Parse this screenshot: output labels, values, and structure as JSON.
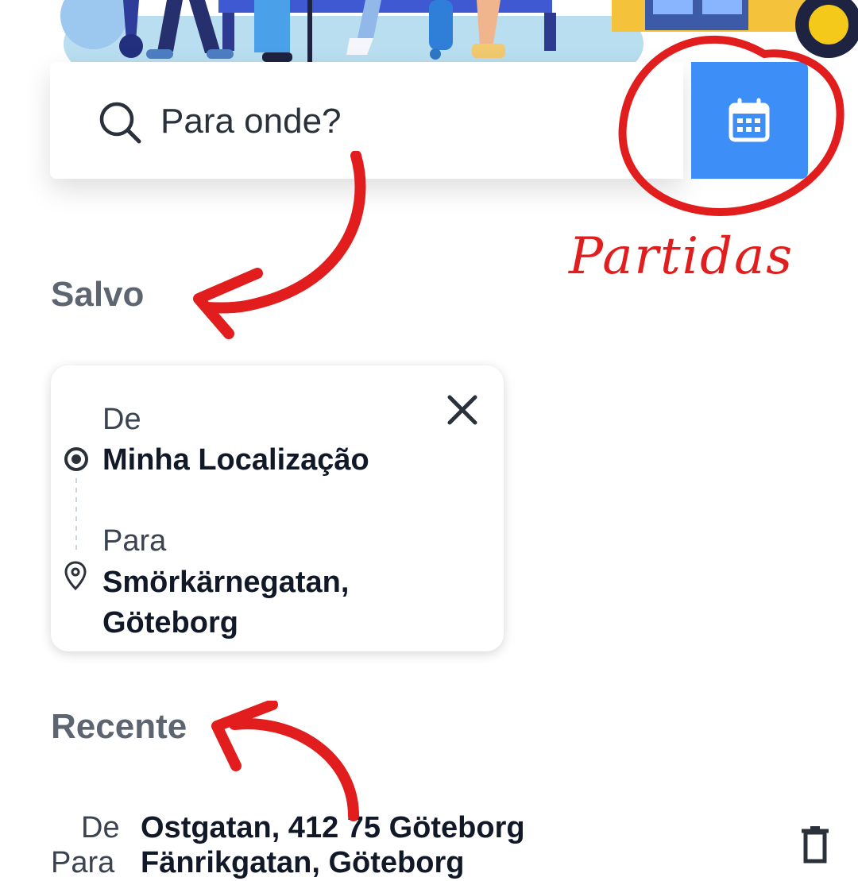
{
  "search": {
    "placeholder": "Para onde?",
    "calendar_icon": "calendar-icon",
    "search_icon": "search-icon"
  },
  "sections": {
    "saved_title": "Salvo",
    "recent_title": "Recente"
  },
  "saved_trip": {
    "from_label": "De",
    "from_value": "Minha Localização",
    "to_label": "Para",
    "to_value": "Smörkärnegatan, Göteborg"
  },
  "recent_trip": {
    "from_label": "De",
    "from_value": "Ostgatan, 412 75 Göteborg",
    "to_label": "Para",
    "to_value": "Fänrikgatan, Göteborg"
  },
  "annotation": {
    "text": "Partidas"
  },
  "colors": {
    "accent": "#3d8ef6",
    "annotation": "#e11d1d",
    "section_title": "#5c6570"
  }
}
